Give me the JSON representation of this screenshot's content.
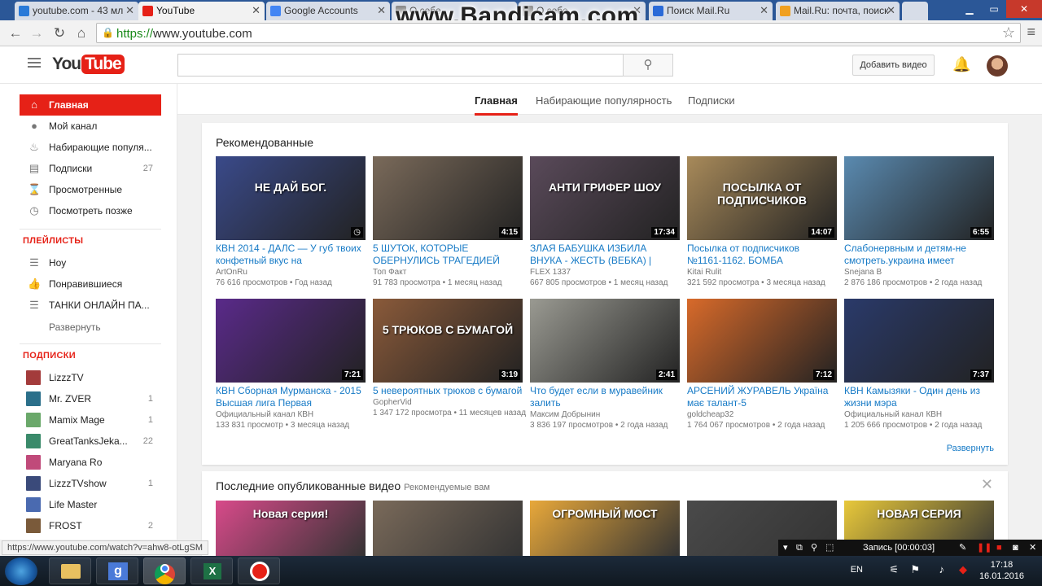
{
  "browser": {
    "tabs": [
      {
        "title": "youtube.com - 43 мл",
        "active": false
      },
      {
        "title": "YouTube",
        "active": true
      },
      {
        "title": "Google Accounts",
        "active": false
      },
      {
        "title": "О себе",
        "active": false
      },
      {
        "title": "О себе",
        "active": false
      },
      {
        "title": "Поиск Mail.Ru",
        "active": false
      },
      {
        "title": "Mail.Ru: почта, поиск",
        "active": false
      }
    ],
    "url_scheme": "https://",
    "url_host": "www.youtube.com",
    "status_url": "https://www.youtube.com/watch?v=ahw8-otLgSM"
  },
  "watermark": "www.Bandicam.com",
  "header": {
    "logo_you": "You",
    "logo_tube": "Tube",
    "search_placeholder": "",
    "upload_label": "Добавить видео"
  },
  "sidebar": {
    "main": [
      {
        "label": "Главная",
        "icon": "home-icon",
        "count": ""
      },
      {
        "label": "Мой канал",
        "icon": "account-icon",
        "count": ""
      },
      {
        "label": "Набирающие популя...",
        "icon": "flame-icon",
        "count": ""
      },
      {
        "label": "Подписки",
        "icon": "subscriptions-icon",
        "count": "27"
      },
      {
        "label": "Просмотренные",
        "icon": "hourglass-icon",
        "count": ""
      },
      {
        "label": "Посмотреть позже",
        "icon": "clock-icon",
        "count": ""
      }
    ],
    "playlists_header": "ПЛЕЙЛИСТЫ",
    "playlists": [
      {
        "label": "Ноу",
        "icon": "playlist-icon"
      },
      {
        "label": "Понравившиеся",
        "icon": "thumbs-up-icon"
      },
      {
        "label": "ТАНКИ ОНЛАЙН ПА...",
        "icon": "playlist-icon"
      }
    ],
    "expand_label": "Развернуть",
    "subs_header": "ПОДПИСКИ",
    "subscriptions": [
      {
        "label": "LizzzTV",
        "count": "",
        "color": "#a33b3b"
      },
      {
        "label": "Mr. ZVER",
        "count": "1",
        "color": "#2b6f8a"
      },
      {
        "label": "Mamix Mage",
        "count": "1",
        "color": "#6aa86a"
      },
      {
        "label": "GreatTanksJeka...",
        "count": "22",
        "color": "#3a8a6a"
      },
      {
        "label": "Maryana Ro",
        "count": "",
        "color": "#c04a7a"
      },
      {
        "label": "LizzzTVshow",
        "count": "1",
        "color": "#3a4a7a"
      },
      {
        "label": "Life Master",
        "count": "",
        "color": "#4a6ab0"
      },
      {
        "label": "FROST",
        "count": "2",
        "color": "#7a5a3a"
      }
    ]
  },
  "subtabs": [
    "Главная",
    "Набирающие популярность",
    "Подписки"
  ],
  "recommended": {
    "title": "Рекомендованные",
    "expand_label": "Развернуть",
    "videos": [
      {
        "title": "КВН 2014 - ДАЛС — У губ твоих конфетный вкус на",
        "channel": "ArtOnRu",
        "views": "76 616 просмотров",
        "age": "Год назад",
        "duration": "",
        "bg": "#3a4a8a",
        "overlay": "НЕ ДАЙ БОГ."
      },
      {
        "title": "5 ШУТОК, КОТОРЫЕ ОБЕРНУЛИСЬ ТРАГЕДИЕЙ",
        "channel": "Топ Факт",
        "views": "91 783 просмотра",
        "age": "1 месяц назад",
        "duration": "4:15",
        "bg": "#7a6a5a",
        "overlay": ""
      },
      {
        "title": "ЗЛАЯ БАБУШКА ИЗБИЛА ВНУКА - ЖЕСТЬ (ВЕБКА) |",
        "channel": "FLEX 1337",
        "views": "667 805 просмотров",
        "age": "1 месяц назад",
        "duration": "17:34",
        "bg": "#5a4a5a",
        "overlay": "АНТИ ГРИФЕР ШОУ"
      },
      {
        "title": "Посылка от подписчиков №1161-1162. БОМБА",
        "channel": "Kitai Rulit",
        "views": "321 592 просмотра",
        "age": "3 месяца назад",
        "duration": "14:07",
        "bg": "#a88a5a",
        "overlay": "ПОСЫЛКА ОТ ПОДПИСЧИКОВ"
      },
      {
        "title": "Слабонервным и детям-не смотреть.украина имеет",
        "channel": "Snejana B",
        "views": "2 876 186 просмотров",
        "age": "2 года назад",
        "duration": "6:55",
        "bg": "#5a8ab0",
        "overlay": ""
      },
      {
        "title": "КВН Сборная Мурманска - 2015 Высшая лига Первая",
        "channel": "Официальный канал КВН",
        "views": "133 831 просмотр",
        "age": "3 месяца назад",
        "duration": "7:21",
        "bg": "#5a2a8a",
        "overlay": ""
      },
      {
        "title": "5 невероятных трюков с бумагой",
        "channel": "GopherVid",
        "views": "1 347 172 просмотра",
        "age": "11 месяцев назад",
        "duration": "3:19",
        "bg": "#8a5a3a",
        "overlay": "5 ТРЮКОВ С БУМАГОЙ"
      },
      {
        "title": "Что будет если в муравейник залить",
        "channel": "Максим Добрынин",
        "views": "3 836 197 просмотров",
        "age": "2 года назад",
        "duration": "2:41",
        "bg": "#9a9a92",
        "overlay": ""
      },
      {
        "title": "АРСЕНИЙ ЖУРАВЕЛЬ Україна має талант-5",
        "channel": "goldcheap32",
        "views": "1 764 067 просмотров",
        "age": "2 года назад",
        "duration": "7:12",
        "bg": "#d86a2a",
        "overlay": ""
      },
      {
        "title": "КВН Камызяки - Один день из жизни мэра",
        "channel": "Официальный канал КВН",
        "views": "1 205 666 просмотров",
        "age": "2 года назад",
        "duration": "7:37",
        "bg": "#2a3a6a",
        "overlay": ""
      }
    ]
  },
  "latest": {
    "title": "Последние опубликованные видео",
    "subtitle": "Рекомендуемые вам",
    "thumbs": [
      {
        "bg": "#d84a8a",
        "overlay": "Новая серия!"
      },
      {
        "bg": "#7a6a5a",
        "overlay": ""
      },
      {
        "bg": "#e8a83a",
        "overlay": "ОГРОМНЫЙ МОСТ"
      },
      {
        "bg": "#4a4a4a",
        "overlay": ""
      },
      {
        "bg": "#e8c83a",
        "overlay": "НОВАЯ СЕРИЯ"
      }
    ]
  },
  "bandicam": {
    "record_label": "Запись [00:00:03]"
  },
  "taskbar": {
    "lang": "EN",
    "time": "17:18",
    "date": "16.01.2016"
  }
}
